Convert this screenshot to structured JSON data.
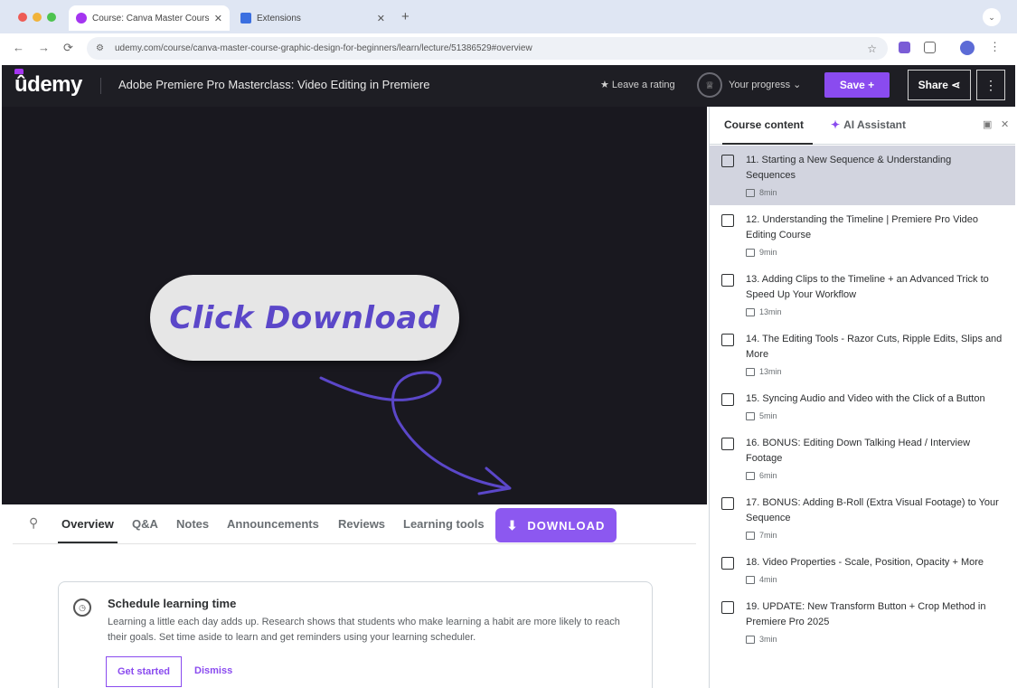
{
  "browser": {
    "tabs": [
      {
        "title": "Course: Canva Master Course",
        "active": true,
        "favicon_color": "#a435f0"
      },
      {
        "title": "Extensions",
        "active": false,
        "favicon_color": "#3b6fe0"
      }
    ],
    "url": "udemy.com/course/canva-master-course-graphic-design-for-beginners/learn/lecture/51386529#overview",
    "icons": {
      "back": "←",
      "forward": "→",
      "reload": "⟳",
      "star": "☆",
      "new_tab": "+",
      "close": "✕",
      "menu": "⋮"
    }
  },
  "header": {
    "logo": "ûdemy",
    "course_title": "Adobe Premiere Pro Masterclass: Video Editing in Premiere",
    "leave_rating": "★ Leave a rating",
    "progress_label": "Your progress ⌄",
    "save_label": "Save +",
    "share_label": "Share ⋖",
    "more_label": "⋮"
  },
  "overlay": {
    "callout_text": "Click Download",
    "accent": "#5b47c9"
  },
  "content_tabs": {
    "items": [
      "Overview",
      "Q&A",
      "Notes",
      "Announcements",
      "Reviews",
      "Learning tools"
    ],
    "active": "Overview",
    "download_label": "DOWNLOAD",
    "download_color": "#8c58f0"
  },
  "schedule": {
    "title": "Schedule learning time",
    "body": "Learning a little each day adds up. Research shows that students who make learning a habit are more likely to reach their goals. Set time aside to learn and get reminders using your learning scheduler.",
    "get_started": "Get started",
    "dismiss": "Dismiss"
  },
  "sidebar": {
    "tab_course_content": "Course content",
    "tab_ai_assistant": "AI Assistant",
    "lectures": [
      {
        "title": "11. Starting a New Sequence & Understanding Sequences",
        "duration": "8min",
        "current": true
      },
      {
        "title": "12. Understanding the Timeline | Premiere Pro Video Editing Course",
        "duration": "9min",
        "current": false
      },
      {
        "title": "13. Adding Clips to the Timeline + an Advanced Trick to Speed Up Your Workflow",
        "duration": "13min",
        "current": false
      },
      {
        "title": "14. The Editing Tools - Razor Cuts, Ripple Edits, Slips and More",
        "duration": "13min",
        "current": false
      },
      {
        "title": "15. Syncing Audio and Video with the Click of a Button",
        "duration": "5min",
        "current": false
      },
      {
        "title": "16. BONUS: Editing Down Talking Head / Interview Footage",
        "duration": "6min",
        "current": false
      },
      {
        "title": "17. BONUS: Adding B-Roll (Extra Visual Footage) to Your Sequence",
        "duration": "7min",
        "current": false
      },
      {
        "title": "18. Video Properties - Scale, Position, Opacity + More",
        "duration": "4min",
        "current": false
      },
      {
        "title": "19. UPDATE: New Transform Button + Crop Method in Premiere Pro 2025",
        "duration": "3min",
        "current": false
      }
    ]
  }
}
